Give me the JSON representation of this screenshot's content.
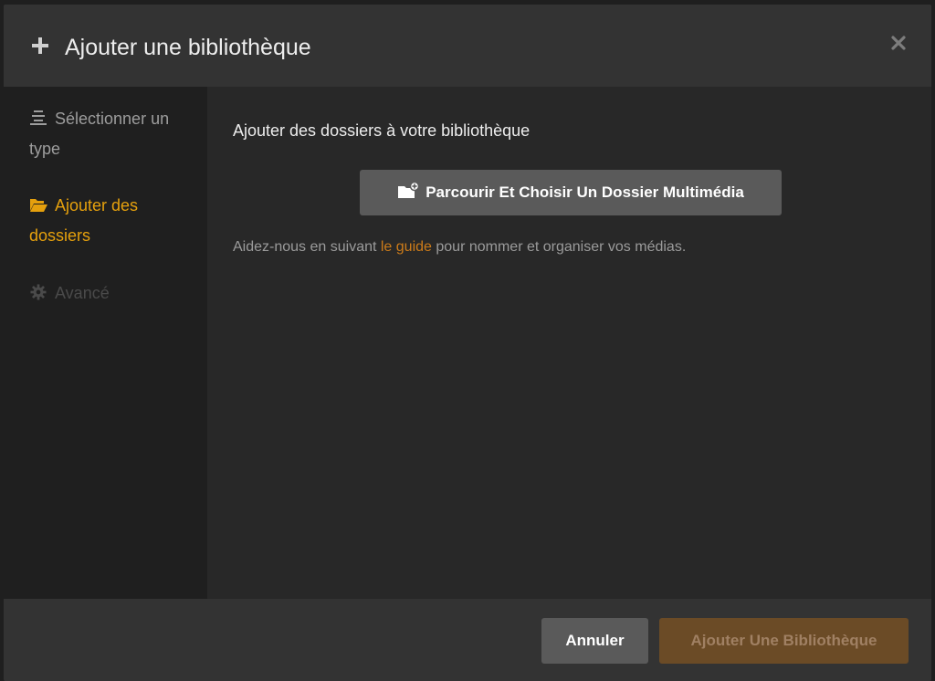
{
  "header": {
    "title": "Ajouter une bibliothèque",
    "plus_icon": "plus-icon",
    "close_icon": "close-icon"
  },
  "sidebar": {
    "items": [
      {
        "label_line1": "Sélectionner un",
        "label_line2": "type",
        "icon": "list-icon",
        "state": "inactive"
      },
      {
        "label_line1": "Ajouter des",
        "label_line2": "dossiers",
        "icon": "folder-open-icon",
        "state": "active"
      },
      {
        "label_line1": "Avancé",
        "icon": "gear-icon",
        "state": "disabled"
      }
    ]
  },
  "content": {
    "heading": "Ajouter des dossiers à votre bibliothèque",
    "browse_button": "Parcourir Et Choisir Un Dossier Multimédia",
    "browse_icon": "folder-add-icon",
    "help_before": "Aidez-nous en suivant ",
    "help_link": "le guide",
    "help_after": " pour nommer et organiser vos médias."
  },
  "footer": {
    "cancel_label": "Annuler",
    "add_label": "Ajouter Une Bibliothèque"
  },
  "colors": {
    "accent": "#e5a00d",
    "link": "#cc7b19",
    "button": "#5a5a5a",
    "primary_disabled": "#6b4b26"
  }
}
